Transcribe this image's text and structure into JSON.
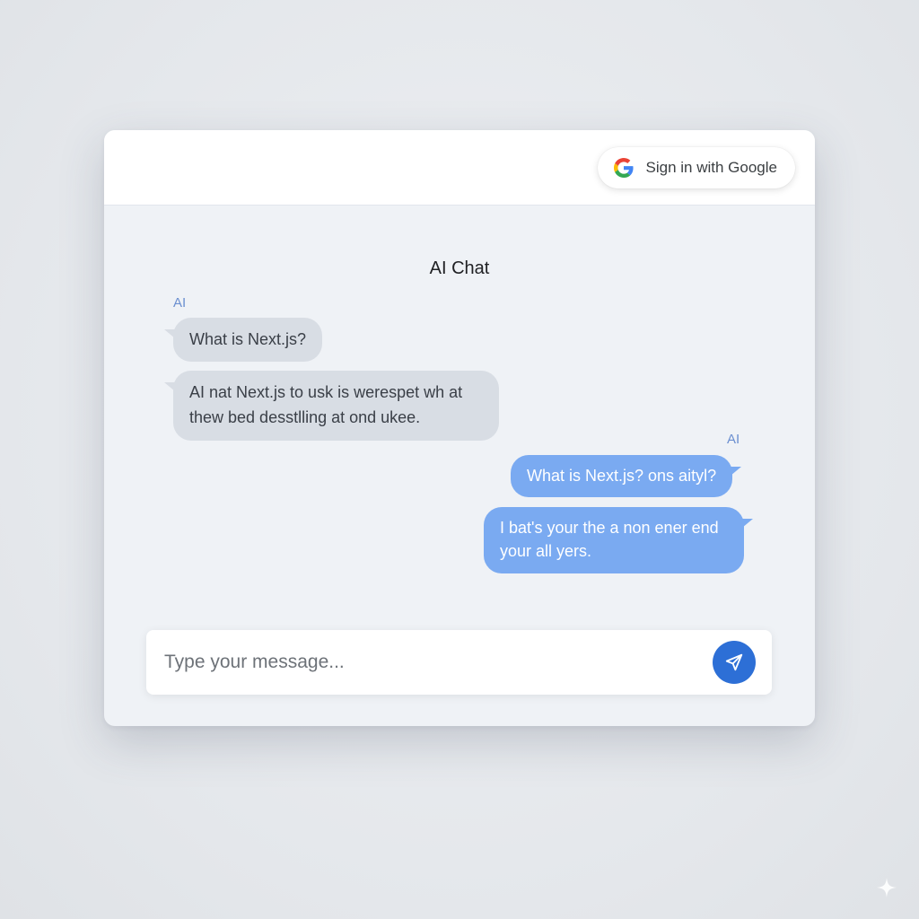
{
  "header": {
    "signin_label": "Sign in with Google",
    "signin_icon": "google-g-icon"
  },
  "chat": {
    "title": "AI Chat",
    "messages": [
      {
        "sender": "AI",
        "side": "left",
        "text": "What is Next.js?"
      },
      {
        "sender": "",
        "side": "left",
        "text": "AI nat Next.js to usk is werespet wh at\nthew bed desstlling at ond ukee."
      },
      {
        "sender": "AI",
        "side": "right",
        "text": "What is Next.js? ons aityl?"
      },
      {
        "sender": "",
        "side": "right",
        "text": "I bat's your the a non ener end\nyour all yers."
      }
    ]
  },
  "composer": {
    "placeholder": "Type your message...",
    "value": "",
    "send_icon": "paper-plane-icon"
  },
  "colors": {
    "accent": "#2d6fd6",
    "user_bubble": "#7aaaf1",
    "ai_bubble": "#d8dde4",
    "sender_label": "#6b8fd0"
  }
}
